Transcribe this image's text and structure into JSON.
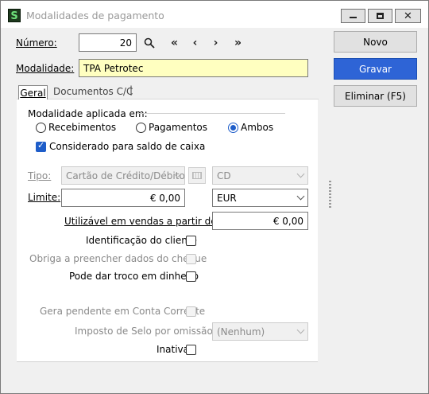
{
  "window": {
    "title": "Modalidades de pagamento",
    "app_icon_letter": "S"
  },
  "header": {
    "numero_label": "Número:",
    "numero_value": "20",
    "modalidade_label": "Modalidade:",
    "modalidade_value": "TPA Petrotec"
  },
  "nav": {
    "first": "«",
    "prev": "‹",
    "next": "›",
    "last": "»"
  },
  "actions": {
    "novo": "Novo",
    "gravar": "Gravar",
    "eliminar": "Eliminar (F5)"
  },
  "tabs": {
    "geral": "Geral",
    "documentos": "Documentos C/C",
    "separator": "|"
  },
  "form": {
    "aplicada_em_label": "Modalidade aplicada em:",
    "radios": {
      "recebimentos": "Recebimentos",
      "pagamentos": "Pagamentos",
      "ambos": "Ambos",
      "selected": "Ambos"
    },
    "saldo_caixa_label": "Considerado para saldo de caixa",
    "saldo_caixa_checked": true,
    "tipo_label": "Tipo:",
    "tipo_value": "Cartão de Crédito/Débito",
    "tipo_code": "CD",
    "limite_label": "Limite:",
    "limite_value": "€ 0,00",
    "moeda_value": "EUR",
    "utilizavel_label": "Utilizável em vendas a partir de:",
    "utilizavel_value": "€ 0,00",
    "identificacao_label": "Identificação do cliente",
    "obriga_label": "Obriga a preencher dados do cheque",
    "troco_label": "Pode dar troco em dinheiro",
    "pendente_label": "Gera pendente em Conta Corrente",
    "imposto_label": "Imposto de Selo por omissão",
    "imposto_value": "(Nenhum)",
    "inativa_label": "Inativa"
  }
}
